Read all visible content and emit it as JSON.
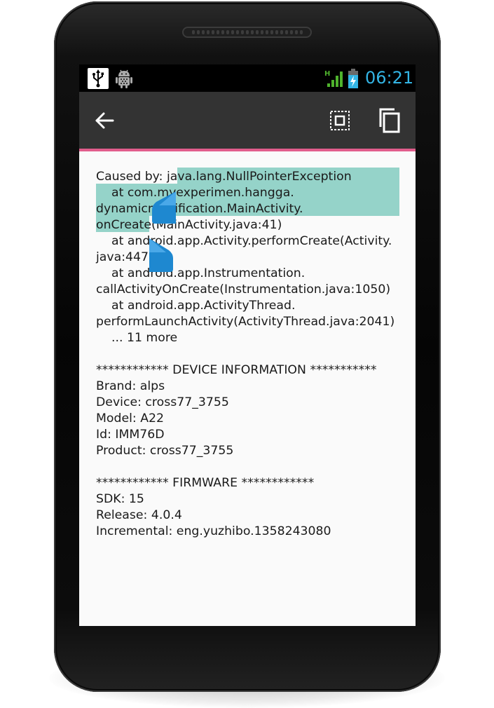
{
  "status_bar": {
    "time": "06:21",
    "icons": [
      "usb-icon",
      "android-debug-icon",
      "signal-h-icon",
      "battery-charging-icon"
    ],
    "clock_color": "#33b5e5"
  },
  "app_bar": {
    "icons": [
      "back-arrow-icon",
      "select-all-icon",
      "copy-icon"
    ],
    "background": "#333333",
    "accent_color": "#e15d8c"
  },
  "log": {
    "lines": [
      "Caused by: java.lang.NullPointerException",
      "    at com.myexperimen.hangga.",
      "dynamicmodification.MainActivity.",
      "onCreate(MainActivity.java:41)",
      "    at android.app.Activity.performCreate(Activity.",
      "java:4479)",
      "    at android.app.Instrumentation.",
      "callActivityOnCreate(Instrumentation.java:1050)",
      "    at android.app.ActivityThread.",
      "performLaunchActivity(ActivityThread.java:2041)",
      "    ... 11 more",
      "",
      "************ DEVICE INFORMATION ***********",
      "Brand: alps",
      "Device: cross77_3755",
      "Model: A22",
      "Id: IMM76D",
      "Product: cross77_3755",
      "",
      "************ FIRMWARE ************",
      "SDK: 15",
      "Release: 4.0.4",
      "Incremental: eng.yuzhibo.1358243080"
    ],
    "selection_color": "#95d3c9",
    "handle_color": "#1e88d0"
  }
}
